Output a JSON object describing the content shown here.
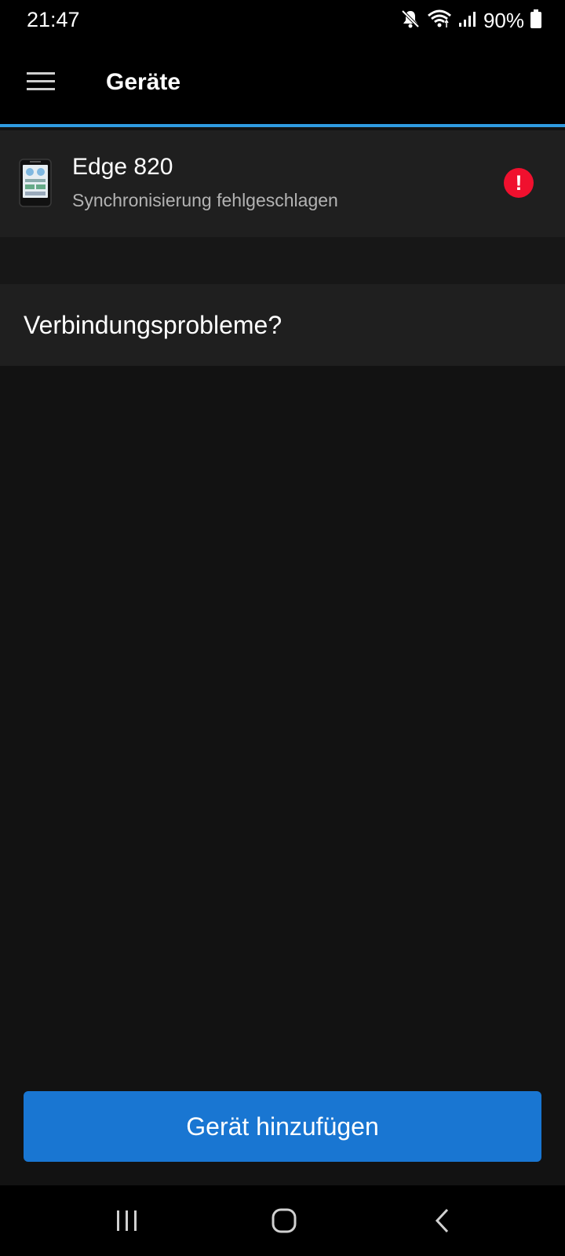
{
  "status_bar": {
    "time": "21:47",
    "battery_percent": "90%",
    "icons": [
      "mute-icon",
      "wifi-icon",
      "signal-icon",
      "battery-icon"
    ]
  },
  "app_bar": {
    "title": "Geräte",
    "menu_icon": "hamburger-menu-icon"
  },
  "device": {
    "name": "Edge 820",
    "status": "Synchronisierung fehlgeschlagen",
    "error_symbol": "!",
    "error_color": "#f0102e"
  },
  "help": {
    "label": "Verbindungsprobleme?"
  },
  "add_device": {
    "label": "Gerät hinzufügen",
    "color": "#1976d2"
  },
  "colors": {
    "accent_line": "#2f9be0",
    "background": "#121212",
    "row_background": "#1f1f1f"
  },
  "nav_bar": {
    "items": [
      "recent-apps-icon",
      "home-icon",
      "back-icon"
    ]
  }
}
